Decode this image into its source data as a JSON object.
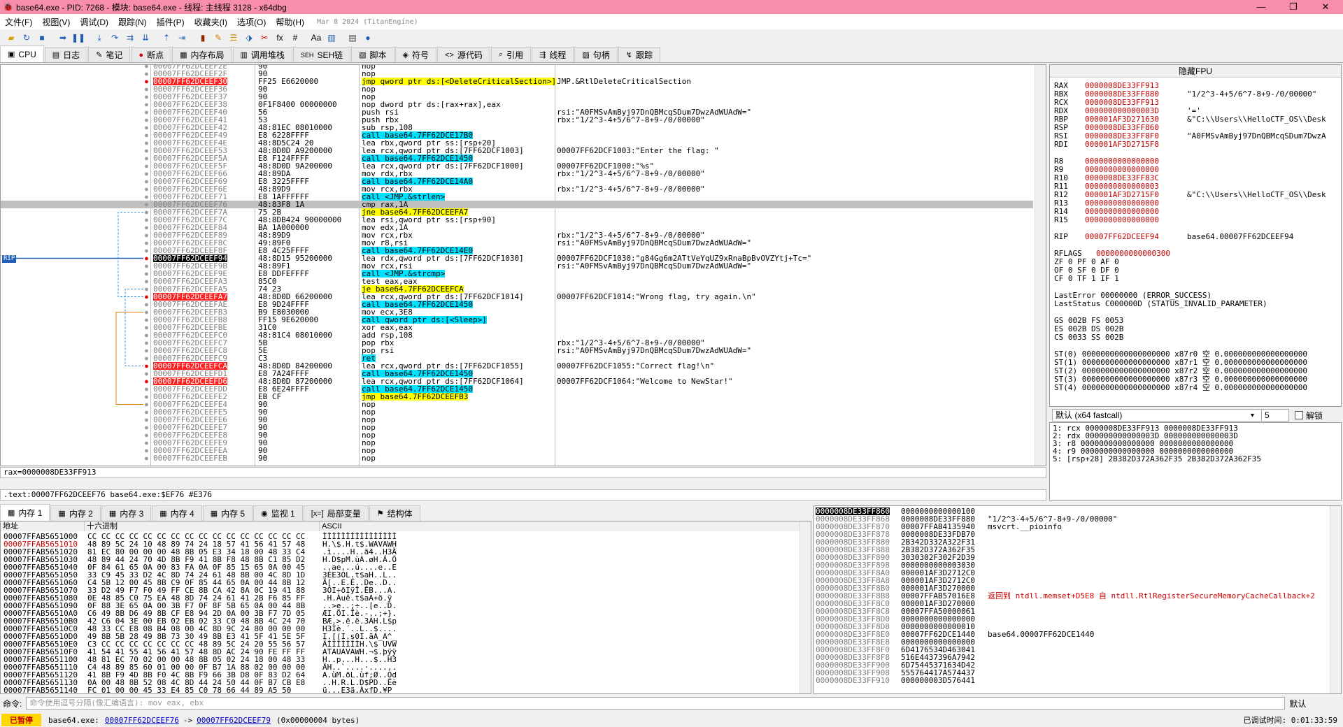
{
  "window": {
    "title": "base64.exe - PID: 7268 - 模块: base64.exe - 线程: 主线程 3128 - x64dbg",
    "minimize": "—",
    "maximize": "❐",
    "close": "✕"
  },
  "menu": {
    "items": [
      "文件(F)",
      "视图(V)",
      "调试(D)",
      "跟踪(N)",
      "插件(P)",
      "收藏夹(I)",
      "选项(O)",
      "帮助(H)"
    ],
    "build": "Mar 8 2024 (TitanEngine)"
  },
  "tabs": [
    {
      "icon": "▣",
      "label": "CPU"
    },
    {
      "icon": "▤",
      "label": "日志"
    },
    {
      "icon": "✎",
      "label": "笔记"
    },
    {
      "icon": "●",
      "label": "断点"
    },
    {
      "icon": "▦",
      "label": "内存布局"
    },
    {
      "icon": "▥",
      "label": "调用堆栈"
    },
    {
      "icon": "SEH",
      "label": "SEH链"
    },
    {
      "icon": "▧",
      "label": "脚本"
    },
    {
      "icon": "◈",
      "label": "符号"
    },
    {
      "icon": "<>",
      "label": "源代码"
    },
    {
      "icon": "⌕",
      "label": "引用"
    },
    {
      "icon": "⇶",
      "label": "线程"
    },
    {
      "icon": "▨",
      "label": "句柄"
    },
    {
      "icon": "↯",
      "label": "跟踪"
    }
  ],
  "disasm": [
    {
      "a": "00007FF62DCEEF2E",
      "b": "90",
      "i": "nop",
      "c": ""
    },
    {
      "a": "00007FF62DCEEF2F",
      "b": "90",
      "i": "nop",
      "c": ""
    },
    {
      "a": "00007FF62DCEEF30",
      "b": "FF25 E6620000",
      "i": "jmp qword ptr ds:[<DeleteCriticalSection>]",
      "c": "JMP.&RtlDeleteCriticalSection",
      "hl": "jmp",
      "red": true
    },
    {
      "a": "00007FF62DCEEF36",
      "b": "90",
      "i": "nop",
      "c": ""
    },
    {
      "a": "00007FF62DCEEF37",
      "b": "90",
      "i": "nop",
      "c": ""
    },
    {
      "a": "00007FF62DCEEF38",
      "b": "0F1F8400 00000000",
      "i": "nop dword ptr ds:[rax+rax],eax",
      "c": ""
    },
    {
      "a": "00007FF62DCEEF40",
      "b": "56",
      "i": "push rsi",
      "c": "rsi:\"A0FMSvAmByj97DnQBMcqSDum7DwzAdWUAdW=\""
    },
    {
      "a": "00007FF62DCEEF41",
      "b": "53",
      "i": "push rbx",
      "c": "rbx:\"1/2^3-4+5/6^7-8+9-/0/00000\""
    },
    {
      "a": "00007FF62DCEEF42",
      "b": "48:81EC 08010000",
      "i": "sub rsp,108",
      "c": ""
    },
    {
      "a": "00007FF62DCEEF49",
      "b": "E8 6228FFFF",
      "i": "call base64.7FF62DCE17B0",
      "c": "",
      "hl": "call"
    },
    {
      "a": "00007FF62DCEEF4E",
      "b": "48:8D5C24 20",
      "i": "lea rbx,qword ptr ss:[rsp+20]",
      "c": ""
    },
    {
      "a": "00007FF62DCEEF53",
      "b": "48:8D0D A9200000",
      "i": "lea rcx,qword ptr ds:[7FF62DCF1003]",
      "c": "00007FF62DCF1003:\"Enter the flag: \""
    },
    {
      "a": "00007FF62DCEEF5A",
      "b": "E8 F124FFFF",
      "i": "call base64.7FF62DCE1450",
      "c": "",
      "hl": "call"
    },
    {
      "a": "00007FF62DCEEF5F",
      "b": "48:8D0D 9A200000",
      "i": "lea rcx,qword ptr ds:[7FF62DCF1000]",
      "c": "00007FF62DCF1000:\"%s\""
    },
    {
      "a": "00007FF62DCEEF66",
      "b": "48:89DA",
      "i": "mov rdx,rbx",
      "c": "rbx:\"1/2^3-4+5/6^7-8+9-/0/00000\""
    },
    {
      "a": "00007FF62DCEEF69",
      "b": "E8 3225FFFF",
      "i": "call base64.7FF62DCE14A0",
      "c": "",
      "hl": "call"
    },
    {
      "a": "00007FF62DCEEF6E",
      "b": "48:89D9",
      "i": "mov rcx,rbx",
      "c": "rbx:\"1/2^3-4+5/6^7-8+9-/0/00000\""
    },
    {
      "a": "00007FF62DCEEF71",
      "b": "E8 1AFFFFFF",
      "i": "call <JMP.&strlen>",
      "c": "",
      "hl": "call"
    },
    {
      "a": "00007FF62DCEEF76",
      "b": "48:83F8 1A",
      "i": "cmp rax,1A",
      "c": "",
      "sel": true
    },
    {
      "a": "00007FF62DCEEF7A",
      "b": "75 2B",
      "i": "jne base64.7FF62DCEEFA7",
      "c": "",
      "hl": "jmp"
    },
    {
      "a": "00007FF62DCEEF7C",
      "b": "48:8DB424 90000000",
      "i": "lea rsi,qword ptr ss:[rsp+90]",
      "c": ""
    },
    {
      "a": "00007FF62DCEEF84",
      "b": "BA 1A000000",
      "i": "mov edx,1A",
      "c": ""
    },
    {
      "a": "00007FF62DCEEF89",
      "b": "48:89D9",
      "i": "mov rcx,rbx",
      "c": "rbx:\"1/2^3-4+5/6^7-8+9-/0/00000\""
    },
    {
      "a": "00007FF62DCEEF8C",
      "b": "49:89F0",
      "i": "mov r8,rsi",
      "c": "rsi:\"A0FMSvAmByj97DnQBMcqSDum7DwzAdWUAdW=\""
    },
    {
      "a": "00007FF62DCEEF8F",
      "b": "E8 4C25FFFF",
      "i": "call base64.7FF62DCE14E0",
      "c": "",
      "hl": "call"
    },
    {
      "a": "00007FF62DCEEF94",
      "b": "48:8D15 95200000",
      "i": "lea rdx,qword ptr ds:[7FF62DCF1030]",
      "c": "00007FF62DCF1030:\"g84Gg6m2ATtVeYqUZ9xRnaBpBvOVZYtj+Tc=\"",
      "rip": true
    },
    {
      "a": "00007FF62DCEEF9B",
      "b": "48:89F1",
      "i": "mov rcx,rsi",
      "c": "rsi:\"A0FMSvAmByj97DnQBMcqSDum7DwzAdWUAdW=\""
    },
    {
      "a": "00007FF62DCEEF9E",
      "b": "E8 DDFEFFFF",
      "i": "call <JMP.&strcmp>",
      "c": "",
      "hl": "call"
    },
    {
      "a": "00007FF62DCEEFA3",
      "b": "85C0",
      "i": "test eax,eax",
      "c": ""
    },
    {
      "a": "00007FF62DCEEFA5",
      "b": "74 23",
      "i": "je base64.7FF62DCEEFCA",
      "c": "",
      "hl": "jmp"
    },
    {
      "a": "00007FF62DCEEFA7",
      "b": "48:8D0D 66200000",
      "i": "lea rcx,qword ptr ds:[7FF62DCF1014]",
      "c": "00007FF62DCF1014:\"Wrong flag, try again.\\n\"",
      "red": true
    },
    {
      "a": "00007FF62DCEEFAE",
      "b": "E8 9D24FFFF",
      "i": "call base64.7FF62DCE1450",
      "c": "",
      "hl": "call"
    },
    {
      "a": "00007FF62DCEEFB3",
      "b": "B9 E8030000",
      "i": "mov ecx,3E8",
      "c": ""
    },
    {
      "a": "00007FF62DCEEFB8",
      "b": "FF15 9E620000",
      "i": "call qword ptr ds:[<Sleep>]",
      "c": "",
      "hl": "call"
    },
    {
      "a": "00007FF62DCEEFBE",
      "b": "31C0",
      "i": "xor eax,eax",
      "c": ""
    },
    {
      "a": "00007FF62DCEEFC0",
      "b": "48:81C4 08010000",
      "i": "add rsp,108",
      "c": ""
    },
    {
      "a": "00007FF62DCEEFC7",
      "b": "5B",
      "i": "pop rbx",
      "c": "rbx:\"1/2^3-4+5/6^7-8+9-/0/00000\""
    },
    {
      "a": "00007FF62DCEEFC8",
      "b": "5E",
      "i": "pop rsi",
      "c": "rsi:\"A0FMSvAmByj97DnQBMcqSDum7DwzAdWUAdW=\""
    },
    {
      "a": "00007FF62DCEEFC9",
      "b": "C3",
      "i": "ret",
      "c": "",
      "hl": "call"
    },
    {
      "a": "00007FF62DCEEFCA",
      "b": "48:8D0D 84200000",
      "i": "lea rcx,qword ptr ds:[7FF62DCF1055]",
      "c": "00007FF62DCF1055:\"Correct flag!\\n\"",
      "red": true
    },
    {
      "a": "00007FF62DCEEFD1",
      "b": "E8 7A24FFFF",
      "i": "call base64.7FF62DCE1450",
      "c": "",
      "hl": "call"
    },
    {
      "a": "00007FF62DCEEFD6",
      "b": "48:8D0D 87200000",
      "i": "lea rcx,qword ptr ds:[7FF62DCF1064]",
      "c": "00007FF62DCF1064:\"Welcome to NewStar!\"",
      "red": true
    },
    {
      "a": "00007FF62DCEEFDD",
      "b": "E8 6E24FFFF",
      "i": "call base64.7FF62DCE1450",
      "c": "",
      "hl": "call"
    },
    {
      "a": "00007FF62DCEEFE2",
      "b": "EB CF",
      "i": "jmp base64.7FF62DCEEFB3",
      "c": "",
      "hl": "jmp"
    },
    {
      "a": "00007FF62DCEEFE4",
      "b": "90",
      "i": "nop",
      "c": ""
    },
    {
      "a": "00007FF62DCEEFE5",
      "b": "90",
      "i": "nop",
      "c": ""
    },
    {
      "a": "00007FF62DCEEFE6",
      "b": "90",
      "i": "nop",
      "c": ""
    },
    {
      "a": "00007FF62DCEEFE7",
      "b": "90",
      "i": "nop",
      "c": ""
    },
    {
      "a": "00007FF62DCEEFE8",
      "b": "90",
      "i": "nop",
      "c": ""
    },
    {
      "a": "00007FF62DCEEFE9",
      "b": "90",
      "i": "nop",
      "c": ""
    },
    {
      "a": "00007FF62DCEEFEA",
      "b": "90",
      "i": "nop",
      "c": ""
    },
    {
      "a": "00007FF62DCEEFEB",
      "b": "90",
      "i": "nop",
      "c": ""
    }
  ],
  "rip_label": "RIP",
  "info1": "rax=0000008DE33FF913",
  "info2": ".text:00007FF62DCEEF76 base64.exe:$EF76 #E376",
  "regs": {
    "header": "隐藏FPU",
    "gp": [
      {
        "n": "RAX",
        "v": "0000008DE33FF913",
        "c": ""
      },
      {
        "n": "RBX",
        "v": "0000008DE33FF880",
        "c": "\"1/2^3-4+5/6^7-8+9-/0/00000\""
      },
      {
        "n": "RCX",
        "v": "0000008DE33FF913",
        "c": ""
      },
      {
        "n": "RDX",
        "v": "000000000000003D",
        "c": "'='"
      },
      {
        "n": "RBP",
        "v": "000001AF3D271630",
        "c": "&\"C:\\\\Users\\\\HelloCTF_OS\\\\Desk"
      },
      {
        "n": "RSP",
        "v": "0000008DE33FF860",
        "c": ""
      },
      {
        "n": "RSI",
        "v": "0000008DE33FF8F0",
        "c": "\"A0FMSvAmByj97DnQBMcqSDum7DwzA"
      },
      {
        "n": "RDI",
        "v": "000001AF3D2715F8",
        "c": ""
      }
    ],
    "ext": [
      {
        "n": "R8",
        "v": "0000000000000000",
        "c": ""
      },
      {
        "n": "R9",
        "v": "0000000000000000",
        "c": ""
      },
      {
        "n": "R10",
        "v": "0000008DE33FF83C",
        "c": ""
      },
      {
        "n": "R11",
        "v": "0000000000000003",
        "c": ""
      },
      {
        "n": "R12",
        "v": "000001AF3D2715F0",
        "c": "&\"C:\\\\Users\\\\HelloCTF_OS\\\\Desk"
      },
      {
        "n": "R13",
        "v": "0000000000000000",
        "c": ""
      },
      {
        "n": "R14",
        "v": "0000000000000000",
        "c": ""
      },
      {
        "n": "R15",
        "v": "0000000000000000",
        "c": ""
      }
    ],
    "rip": {
      "n": "RIP",
      "v": "00007FF62DCEEF94",
      "c": "base64.00007FF62DCEEF94"
    },
    "rflags": {
      "n": "RFLAGS",
      "v": "0000000000000300"
    },
    "flags": [
      "ZF 0  PF 0  AF 0",
      "OF 0  SF 0  DF 0",
      "CF 0  TF 1  IF 1"
    ],
    "lasterror": "LastError  00000000 (ERROR_SUCCESS)",
    "laststatus": "LastStatus C000000D (STATUS_INVALID_PARAMETER)",
    "seg": [
      "GS 002B  FS 0053",
      "ES 002B  DS 002B",
      "CS 0033  SS 002B"
    ],
    "fpu": [
      "ST(0) 0000000000000000000 x87r0 空 0.000000000000000000",
      "ST(1) 0000000000000000000 x87r1 空 0.000000000000000000",
      "ST(2) 0000000000000000000 x87r2 空 0.000000000000000000",
      "ST(3) 0000000000000000000 x87r3 空 0.000000000000000000",
      "ST(4) 0000000000000000000 x87r4 空 0.000000000000000000"
    ]
  },
  "callconv": {
    "label": "默认 (x64 fastcall)",
    "count": "5",
    "unlock": "解锁"
  },
  "stackargs": [
    "1: rcx 0000008DE33FF913 0000008DE33FF913",
    "2: rdx 000000000000003D 000000000000003D",
    "3: r8 0000000000000000 0000000000000000",
    "4: r9 0000000000000000 0000000000000000",
    "5: [rsp+28] 2B382D372A362F35 2B382D372A362F35"
  ],
  "dumptabs": [
    {
      "icon": "▦",
      "label": "内存 1"
    },
    {
      "icon": "▦",
      "label": "内存 2"
    },
    {
      "icon": "▦",
      "label": "内存 3"
    },
    {
      "icon": "▦",
      "label": "内存 4"
    },
    {
      "icon": "▦",
      "label": "内存 5"
    },
    {
      "icon": "◉",
      "label": "监视 1"
    },
    {
      "icon": "[x=]",
      "label": "局部变量"
    },
    {
      "icon": "⚑",
      "label": "结构体"
    }
  ],
  "dump": {
    "h_addr": "地址",
    "h_hex": "十六进制",
    "h_ascii": "ASCII",
    "rows": [
      {
        "a": "00007FFAB5651000",
        "h": "CC CC CC CC CC CC CC CC CC CC CC CC CC CC CC CC",
        "s": "ÌÌÌÌÌÌÌÌÌÌÌÌÌÌÌÌ"
      },
      {
        "a": "00007FFAB5651010",
        "h": "48 89 5C 24 10 48 89 74 24 18 57 41 56 41 57 48",
        "s": "H.\\$.H.t$.WAVAWH",
        "red": true
      },
      {
        "a": "00007FFAB5651020",
        "h": "81 EC 80 00 00 00 48 8B 05 E3 34 18 00 48 33 C4",
        "s": ".ì....H..ã4..H3Ä"
      },
      {
        "a": "00007FFAB5651030",
        "h": "48 89 44 24 70 4D 8B F9 41 8B F8 48 8B C1 85 D2",
        "s": "H.D$pM.ùA.øH.Á.Ò"
      },
      {
        "a": "00007FFAB5651040",
        "h": "0F 84 61 65 0A 00 83 FA 0A 0F 85 15 65 0A 00 45",
        "s": "..ae...ú....e..E"
      },
      {
        "a": "00007FFAB5651050",
        "h": "33 C9 45 33 D2 4C 8D 74 24 61 48 8B 00 4C 8D 1D",
        "s": "3ÉE3ÒL.t$aH..L.."
      },
      {
        "a": "00007FFAB5651060",
        "h": "C4 5B 12 00 45 8B C9 0F 85 44 65 0A 00 44 8B 12",
        "s": "Ä[..E.É..De..D.."
      },
      {
        "a": "00007FFAB5651070",
        "h": "33 D2 49 F7 F0 49 FF CE 8B CA 42 8A 0C 19 41 88",
        "s": "3ÒI÷ðIÿÎ.ÊB...A."
      },
      {
        "a": "00007FFAB5651080",
        "h": "0E 48 85 C0 75 EA 48 8D 74 24 61 41 2B F6 85 FF",
        "s": ".H.Àuê.t$aA+ö.ÿ"
      },
      {
        "a": "00007FFAB5651090",
        "h": "0F 88 3E 65 0A 00 3B F7 0F 8F 5B 65 0A 00 44 8B",
        "s": "..>e..;÷..[e..D."
      },
      {
        "a": "00007FFAB56510A0",
        "h": "C6 49 8B D6 49 8B CF E8 94 2D 0A 00 3B F7 7D 05",
        "s": "ÆI.ÖI.Ïè.-..;÷}."
      },
      {
        "a": "00007FFAB56510B0",
        "h": "42 C6 04 3E 00 EB 02 EB 02 33 C0 48 8B 4C 24 70",
        "s": "BÆ.>.ë.ë.3ÀH.L$p"
      },
      {
        "a": "00007FFAB56510C0",
        "h": "48 33 CC E8 08 B4 08 00 4C 8D 9C 24 80 00 00 00",
        "s": "H3Ìè.´..L..$...."
      },
      {
        "a": "00007FFAB56510D0",
        "h": "49 8B 5B 28 49 8B 73 30 49 8B E3 41 5F 41 5E 5F",
        "s": "I.[(I.s0I.ãA_A^_"
      },
      {
        "a": "00007FFAB56510E0",
        "h": "C3 CC CC CC CC CC CC CC 48 89 5C 24 20 55 56 57",
        "s": "ÃÌÌÌÌÌÌÌH.\\$ UVW"
      },
      {
        "a": "00007FFAB56510F0",
        "h": "41 54 41 55 41 56 41 57 48 8D AC 24 90 FE FF FF",
        "s": "ATAUAVAWH.¬$.þÿÿ"
      },
      {
        "a": "00007FFAB5651100",
        "h": "48 81 EC 70 02 00 00 48 8B 05 02 24 18 00 48 33",
        "s": "H..p...H...$..H3"
      },
      {
        "a": "00007FFAB5651110",
        "h": "C4 48 89 85 60 01 00 00 0F B7 1A 88 02 00 00 00",
        "s": "ÄH..`....·......"
      },
      {
        "a": "00007FFAB5651120",
        "h": "41 8B F9 4D 8B F0 4C 8B F9 66 3B D8 0F 83 D2 64",
        "s": "A.ùM.ðL.ùf;Ø..Òd"
      },
      {
        "a": "00007FFAB5651130",
        "h": "0A 00 48 8B 52 08 4C 8D 44 24 50 44 0F B7 CB E8",
        "s": "..H.R.L.D$PD..Ëè"
      },
      {
        "a": "00007FFAB5651140",
        "h": "FC 01 00 00 45 33 E4 85 C0 78 66 44 89 A5 50 ",
        "s": "ü...E3ä.ÀxfD.¥P"
      }
    ]
  },
  "stack": [
    {
      "a": "0000008DE33FF860",
      "v": "0000000000000100",
      "c": "",
      "top": true
    },
    {
      "a": "0000008DE33FF868",
      "v": "0000008DE33FF880",
      "c": "\"1/2^3-4+5/6^7-8+9-/0/00000\""
    },
    {
      "a": "0000008DE33FF870",
      "v": "00007FFAB4135940",
      "c": "msvcrt.__pioinfo",
      "red": true
    },
    {
      "a": "0000008DE33FF878",
      "v": "0000008DE33FDB70",
      "c": ""
    },
    {
      "a": "0000008DE33FF880",
      "v": "2B342D332A322F31",
      "c": ""
    },
    {
      "a": "0000008DE33FF888",
      "v": "2B382D372A362F35",
      "c": ""
    },
    {
      "a": "0000008DE33FF890",
      "v": "3030302F302F2D39",
      "c": ""
    },
    {
      "a": "0000008DE33FF898",
      "v": "0000000000003030",
      "c": ""
    },
    {
      "a": "0000008DE33FF8A0",
      "v": "000001AF3D2712C0",
      "c": ""
    },
    {
      "a": "0000008DE33FF8A8",
      "v": "000001AF3D2712C0",
      "c": ""
    },
    {
      "a": "0000008DE33FF8B0",
      "v": "000001AF3D270000",
      "c": ""
    },
    {
      "a": "0000008DE33FF8B8",
      "v": "00007FFAB57016E8",
      "c": "返回到 ntdll.memset+D5E8 自 ntdll.RtlRegisterSecureMemoryCacheCallback+2",
      "ret": true
    },
    {
      "a": "0000008DE33FF8C0",
      "v": "000001AF3D270000",
      "c": ""
    },
    {
      "a": "0000008DE33FF8C8",
      "v": "00007FFA50000061",
      "c": ""
    },
    {
      "a": "0000008DE33FF8D0",
      "v": "0000000000000000",
      "c": ""
    },
    {
      "a": "0000008DE33FF8D8",
      "v": "0000000000000010",
      "c": ""
    },
    {
      "a": "0000008DE33FF8E0",
      "v": "00007FF62DCE1440",
      "c": "base64.00007FF62DCE1440"
    },
    {
      "a": "0000008DE33FF8E8",
      "v": "0000000000000000",
      "c": ""
    },
    {
      "a": "0000008DE33FF8F0",
      "v": "6D4176534D463041",
      "c": ""
    },
    {
      "a": "0000008DE33FF8F8",
      "v": "516E4437396A7942",
      "c": ""
    },
    {
      "a": "0000008DE33FF900",
      "v": "6D75445371634D42",
      "c": ""
    },
    {
      "a": "0000008DE33FF908",
      "v": "555764417A574437",
      "c": ""
    },
    {
      "a": "0000008DE33FF910",
      "v": "000000003D576441",
      "c": ""
    }
  ],
  "cmd": {
    "label": "命令:",
    "placeholder": "命令使用逗号分隔(像汇编语言): mov eax, ebx",
    "right": "默认"
  },
  "status": {
    "paused": "已暂停",
    "module": "base64.exe:",
    "from": "00007FF62DCEEF76",
    "arrow": "->",
    "to": "00007FF62DCEEF79",
    "bytes": "(0x00000004 bytes)",
    "time": "已调试时间:  0:01:33:59"
  }
}
